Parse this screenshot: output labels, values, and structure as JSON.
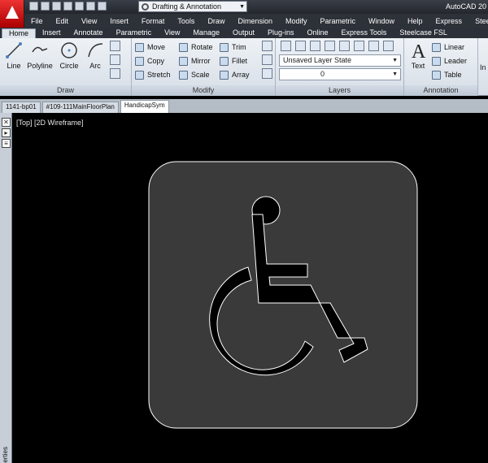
{
  "window": {
    "app_title": "AutoCAD 20",
    "workspace": "Drafting & Annotation"
  },
  "menu": [
    "File",
    "Edit",
    "View",
    "Insert",
    "Format",
    "Tools",
    "Draw",
    "Dimension",
    "Modify",
    "Parametric",
    "Window",
    "Help",
    "Express",
    "Stee"
  ],
  "ribbon_tabs": [
    "Home",
    "Insert",
    "Annotate",
    "Parametric",
    "View",
    "Manage",
    "Output",
    "Plug-ins",
    "Online",
    "Express Tools",
    "Steelcase FSL"
  ],
  "panels": {
    "draw": {
      "title": "Draw",
      "tools": [
        "Line",
        "Polyline",
        "Circle",
        "Arc"
      ]
    },
    "modify": {
      "title": "Modify",
      "tools": [
        "Move",
        "Rotate",
        "Trim",
        "Copy",
        "Mirror",
        "Fillet",
        "Stretch",
        "Scale",
        "Array"
      ]
    },
    "layers": {
      "title": "Layers",
      "layer_state": "Unsaved Layer State",
      "current_layer": "0"
    },
    "annotation": {
      "title": "Annotation",
      "text_label": "Text",
      "tools": [
        "Linear",
        "Leader",
        "Table"
      ],
      "next_label": "In"
    }
  },
  "file_tabs": [
    "1141-bp01",
    "#109-111MainFloorPlan",
    "HandicapSym"
  ],
  "active_file": "HandicapSym",
  "viewport_label": "[Top] [2D Wireframe]",
  "side_palette_label": "perties",
  "colors": {
    "canvas": "#000000",
    "symbol_fill": "#3a3a3a",
    "symbol_outline": "#ffffff"
  }
}
